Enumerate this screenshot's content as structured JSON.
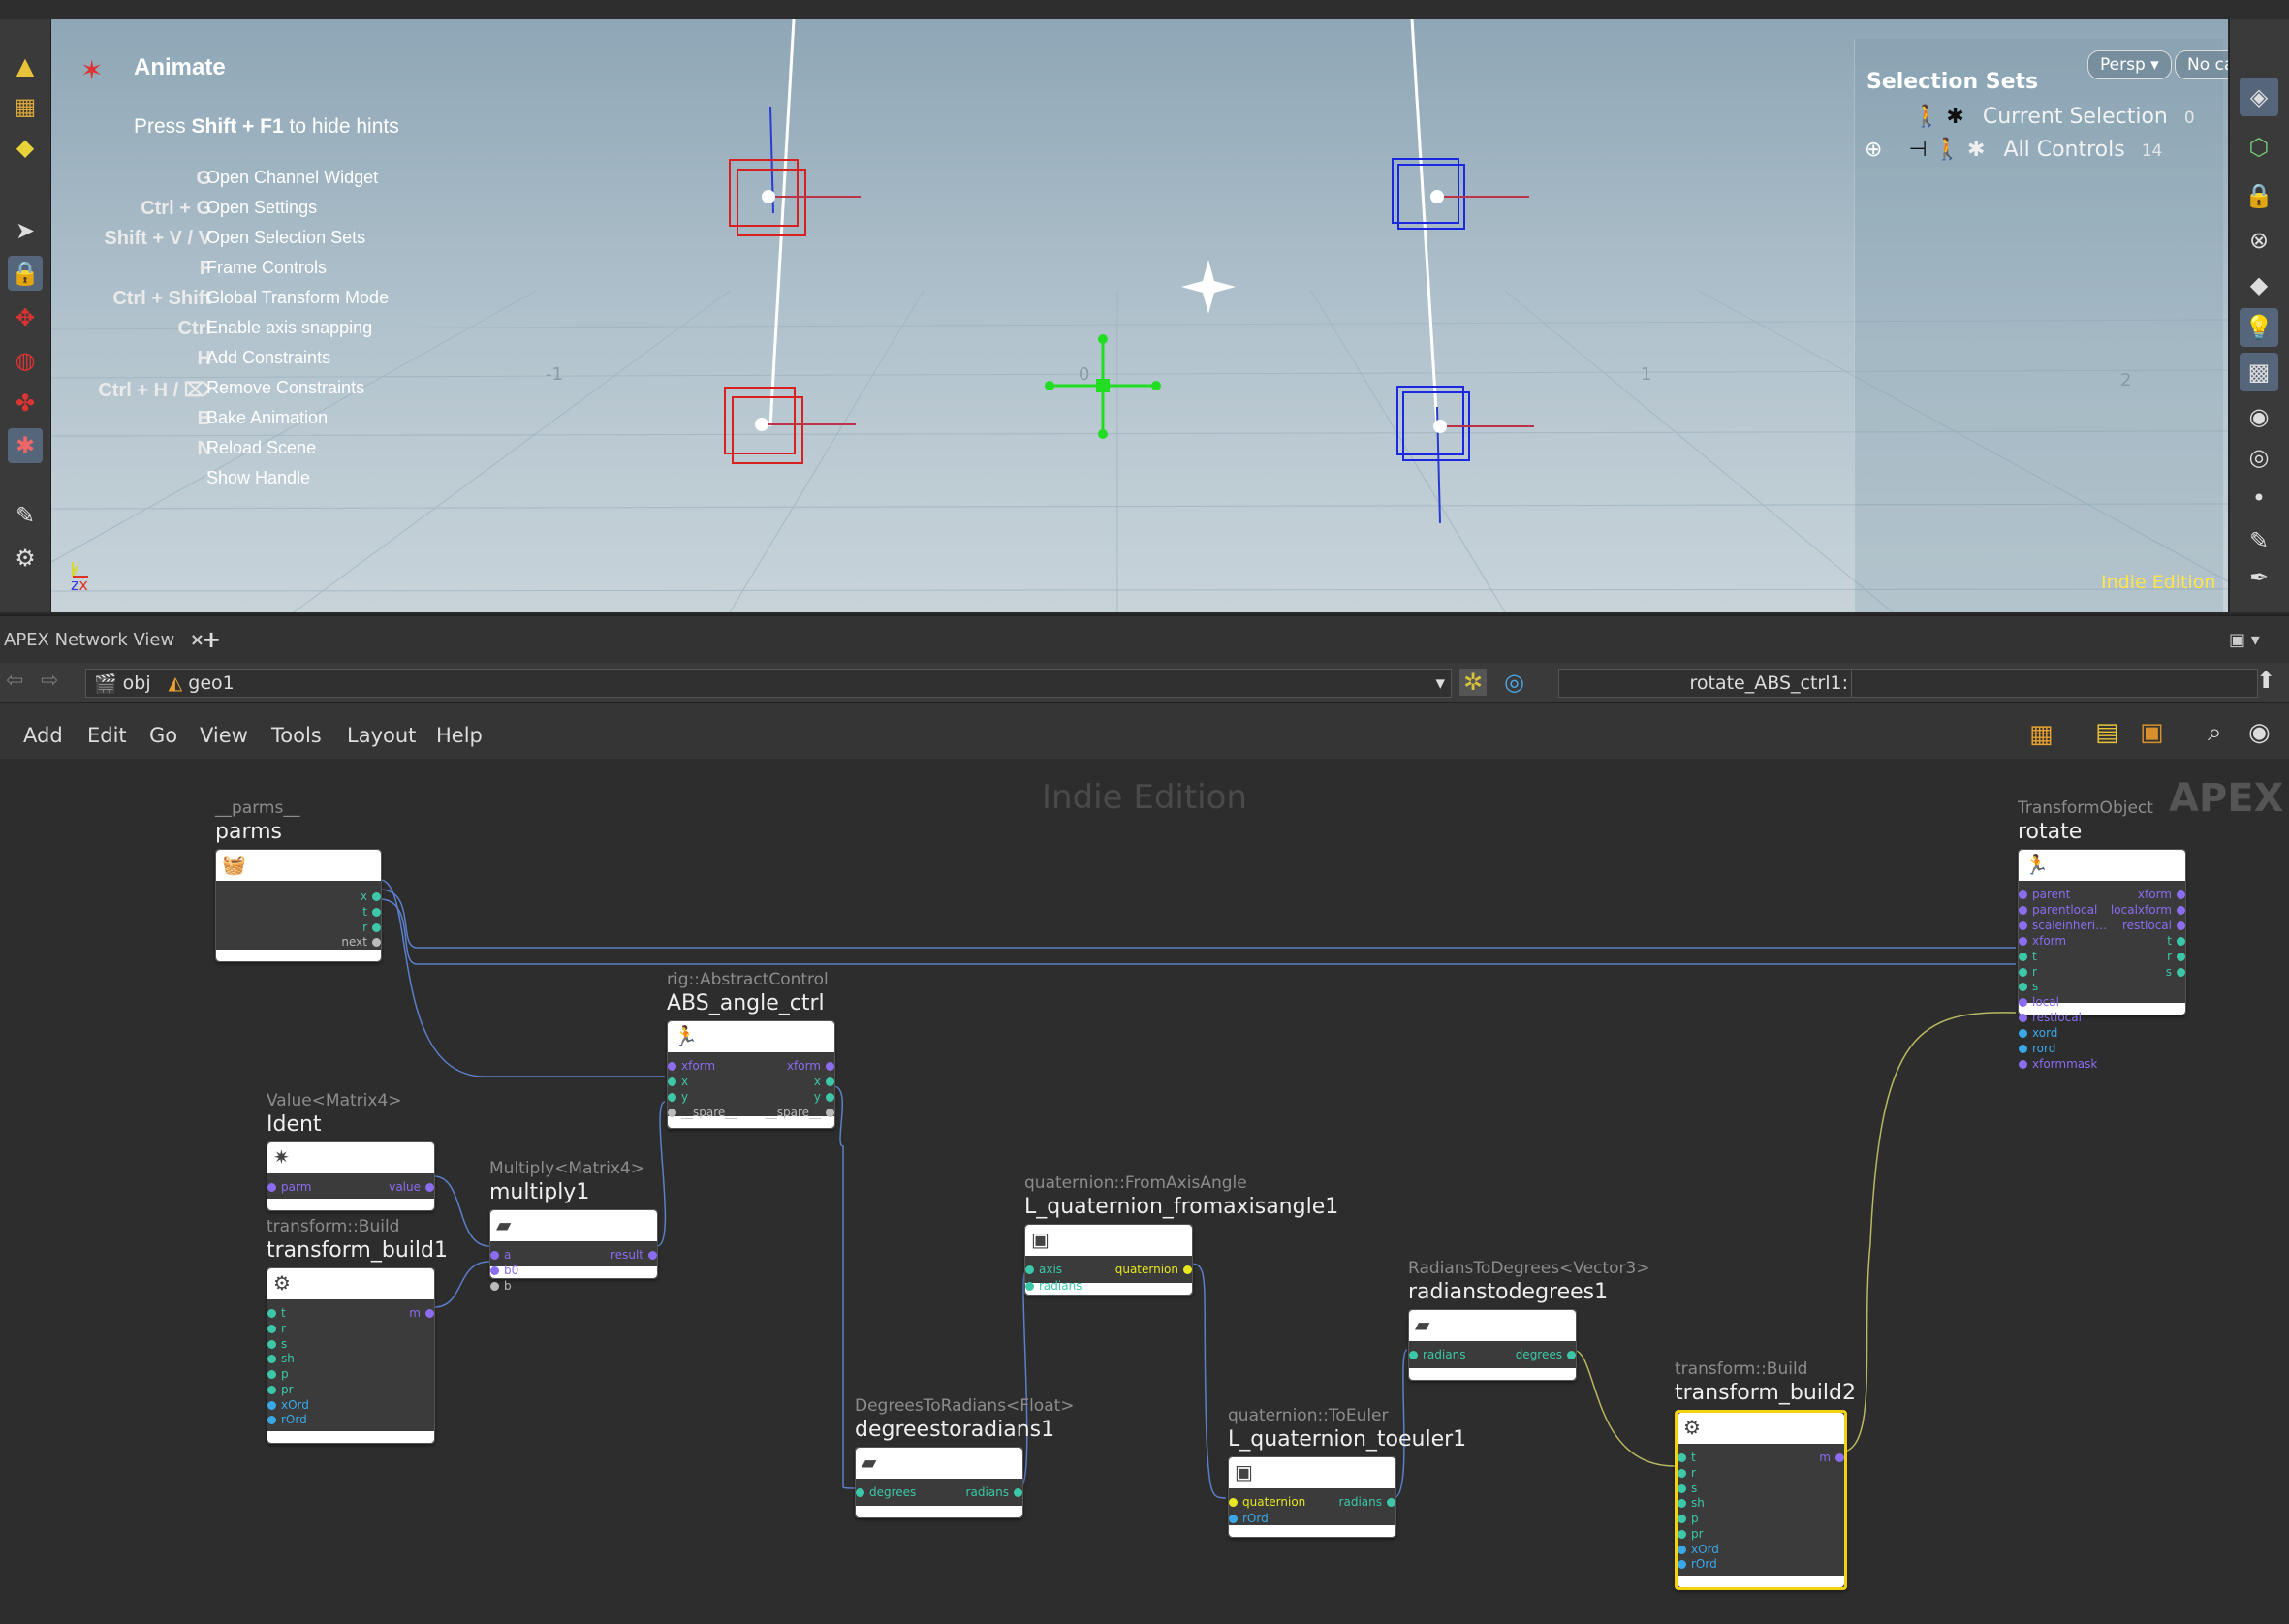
{
  "viewport": {
    "mode_title": "Animate",
    "hint_press_key": "Shift + F1",
    "hint_press_prefix": "Press",
    "hint_press_suffix": "to hide hints",
    "hints": [
      {
        "key": "G",
        "label": "Open Channel Widget"
      },
      {
        "key": "Ctrl + G",
        "label": "Open Settings"
      },
      {
        "key": "Shift + V / V",
        "label": "Open Selection Sets"
      },
      {
        "key": "F",
        "label": "Frame Controls"
      },
      {
        "key": "Ctrl + Shift",
        "label": "Global Transform Mode"
      },
      {
        "key": "Ctrl",
        "label": "Enable axis snapping"
      },
      {
        "key": "H",
        "label": "Add Constraints"
      },
      {
        "key": "Ctrl + H / ⌦",
        "label": "Remove Constraints"
      },
      {
        "key": "B",
        "label": "Bake Animation"
      },
      {
        "key": "N",
        "label": "Reload Scene"
      },
      {
        "key": "'",
        "label": "Show Handle"
      }
    ],
    "camera_button": "Persp",
    "cam_button": "No cam",
    "selection_sets": {
      "title": "Selection Sets",
      "items": [
        {
          "label": "Current Selection",
          "count": "0"
        },
        {
          "label": "All Controls",
          "count": "14"
        }
      ]
    },
    "edition": "Indie Edition",
    "axis_labels": {
      "y": "y",
      "z": "z",
      "x": "x"
    },
    "ground_labels": [
      "-1",
      "0",
      "1",
      "2"
    ]
  },
  "pane_tab": {
    "label": "APEX Network View",
    "close": "×",
    "add": "+"
  },
  "path_bar": {
    "crumbs": [
      "obj",
      "geo1"
    ],
    "parm_label": "rotate_ABS_ctrl1:",
    "parm_value": ""
  },
  "menu": [
    "Add",
    "Edit",
    "Go",
    "View",
    "Tools",
    "Layout",
    "Help"
  ],
  "network": {
    "watermark": "Indie Edition",
    "logo": "APEX",
    "nodes": {
      "parms": {
        "type": "__parms__",
        "name": "parms",
        "outputs": [
          "x",
          "t",
          "r",
          "next"
        ]
      },
      "rotate": {
        "type": "TransformObject",
        "name": "rotate",
        "inputs": [
          "parent",
          "parentlocal",
          "scaleinheri…",
          "xform",
          "t",
          "r",
          "s",
          "local",
          "restlocal",
          "xord",
          "rord",
          "xformmask"
        ],
        "outputs": [
          "xform",
          "localxform",
          "restlocal",
          "t",
          "r",
          "s"
        ]
      },
      "abs": {
        "type": "rig::AbstractControl",
        "name": "ABS_angle_ctrl",
        "inputs": [
          "xform",
          "x",
          "y",
          "__spare__"
        ],
        "outputs": [
          "xform",
          "x",
          "y",
          "__spare__"
        ]
      },
      "ident": {
        "type": "Value<Matrix4>",
        "name": "Ident",
        "inputs": [
          "parm"
        ],
        "outputs": [
          "value"
        ]
      },
      "multiply": {
        "type": "Multiply<Matrix4>",
        "name": "multiply1",
        "inputs": [
          "a",
          "b0",
          "b"
        ],
        "outputs": [
          "result"
        ]
      },
      "tb1": {
        "type": "transform::Build",
        "name": "transform_build1",
        "inputs": [
          "t",
          "r",
          "s",
          "sh",
          "p",
          "pr",
          "xOrd",
          "rOrd"
        ],
        "outputs": [
          "m"
        ]
      },
      "fromaxis": {
        "type": "quaternion::FromAxisAngle",
        "name": "L_quaternion_fromaxisangle1",
        "inputs": [
          "axis",
          "radians"
        ],
        "outputs": [
          "quaternion"
        ]
      },
      "d2r": {
        "type": "DegreesToRadians<Float>",
        "name": "degreestoradians1",
        "inputs": [
          "degrees"
        ],
        "outputs": [
          "radians"
        ]
      },
      "toeuler": {
        "type": "quaternion::ToEuler",
        "name": "L_quaternion_toeuler1",
        "inputs": [
          "quaternion",
          "rOrd"
        ],
        "outputs": [
          "radians"
        ]
      },
      "r2d": {
        "type": "RadiansToDegrees<Vector3>",
        "name": "radianstodegrees1",
        "inputs": [
          "radians"
        ],
        "outputs": [
          "degrees"
        ]
      },
      "tb2": {
        "type": "transform::Build",
        "name": "transform_build2",
        "inputs": [
          "t",
          "r",
          "s",
          "sh",
          "p",
          "pr",
          "xOrd",
          "rOrd"
        ],
        "outputs": [
          "m"
        ]
      }
    }
  },
  "colors": {
    "port_purple": "#8c6cf0",
    "port_teal": "#3cc8a8",
    "port_blue": "#3aa8e8",
    "port_yellow": "#e8e820",
    "port_grey": "#bbbbbb",
    "wire": "#5b7fc8",
    "wire_yellow": "#b8b860",
    "selected": "#f2d20a"
  }
}
